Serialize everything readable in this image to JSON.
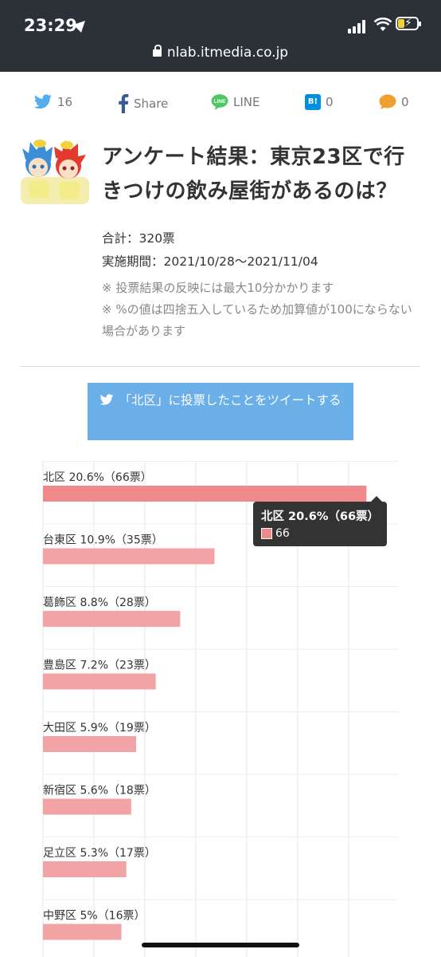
{
  "status_bar": {
    "time": "23:29"
  },
  "browser": {
    "url": "nlab.itmedia.co.jp"
  },
  "share": {
    "twitter_count": "16",
    "facebook_label": "Share",
    "line_label": "LINE",
    "hatena_label": "B!",
    "hatena_count": "0",
    "comment_count": "0"
  },
  "article": {
    "title": "アンケート結果：東京23区で行きつけの飲み屋街があるのは？",
    "total": "合計：320票",
    "period": "実施期間：2021/10/28〜2021/11/04",
    "note1": "※ 投票結果の反映には最大10分かかります",
    "note2": "※ %の値は四捨五入しているため加算値が100にならない場合があります"
  },
  "tweet_button": {
    "label": "「北区」に投票したことをツイートする"
  },
  "chart_data": {
    "type": "bar",
    "orientation": "horizontal",
    "categories": [
      "北区",
      "台東区",
      "葛飾区",
      "豊島区",
      "大田区",
      "新宿区",
      "足立区",
      "中野区"
    ],
    "labels": [
      "北区 20.6%（66票）",
      "台東区 10.9%（35票）",
      "葛飾区 8.8%（28票）",
      "豊島区 7.2%（23票）",
      "大田区 5.9%（19票）",
      "新宿区 5.6%（18票）",
      "足立区 5.3%（17票）",
      "中野区 5%（16票）"
    ],
    "values": [
      66,
      35,
      28,
      23,
      19,
      18,
      17,
      16
    ],
    "xlim": [
      0,
      70
    ],
    "grid": true,
    "bar_color": "#f2a3a6",
    "highlight_color": "#f08a8a",
    "tooltip": {
      "title": "北区 20.6%（66票）",
      "value": "66"
    }
  },
  "colors": {
    "twitter": "#55acee",
    "facebook": "#3b5998",
    "line": "#4cc764",
    "hatena": "#008fde",
    "comment": "#f0a030"
  }
}
